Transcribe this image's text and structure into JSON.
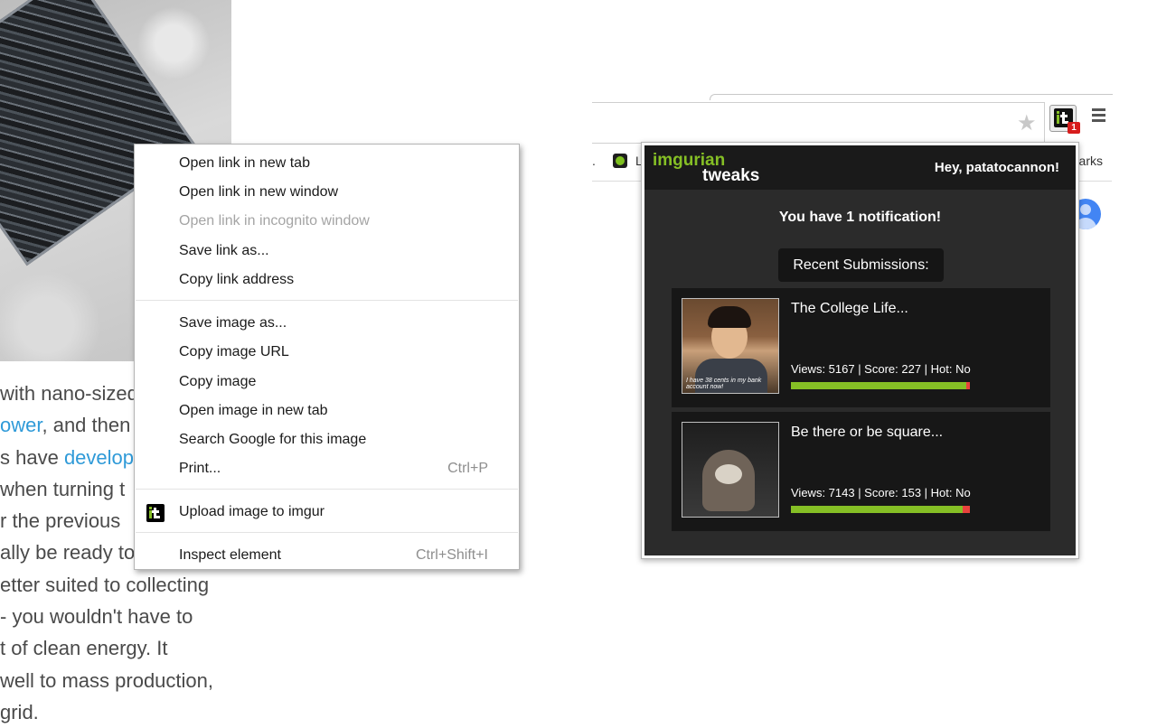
{
  "article": {
    "lines": [
      {
        "text": "with nano-sized",
        "link": ""
      },
      {
        "text": ", and then",
        "link": "ower"
      },
      {
        "text": "s have ",
        "link": "develop"
      },
      {
        "text": " when turning t",
        "link": ""
      },
      {
        "text": "r the previous",
        "link": ""
      },
      {
        "text": "ally be ready to",
        "link": ""
      },
      {
        "text": "etter suited to collecting",
        "link": ""
      },
      {
        "text": "- you wouldn't have to",
        "link": ""
      },
      {
        "text": "t of clean energy. It",
        "link": ""
      },
      {
        "text": "well to mass production,",
        "link": ""
      },
      {
        "text": "grid.",
        "link": ""
      }
    ]
  },
  "context_menu": {
    "group1": [
      "Open link in new tab",
      "Open link in new window",
      "Open link in incognito window",
      "Save link as...",
      "Copy link address"
    ],
    "group2": [
      "Save image as...",
      "Copy image URL",
      "Copy image",
      "Open image in new tab",
      "Search Google for this image",
      "Print..."
    ],
    "print_shortcut": "Ctrl+P",
    "extension_item": "Upload image to imgur",
    "inspect": "Inspect element",
    "inspect_shortcut": "Ctrl+Shift+I"
  },
  "toolbar": {
    "extension_badge": "1",
    "bookmark_fragment": "L",
    "bookmark_dots": ".",
    "bookmarks_fragment": "arks"
  },
  "popup": {
    "logo_top": "imgurian",
    "logo_bottom": "tweaks",
    "greeting": "Hey, patatocannon!",
    "notification": "You have 1 notification!",
    "recent_button": "Recent Submissions:",
    "submissions": [
      {
        "title": "The College Life...",
        "stats": "Views: 5167 | Score: 227 | Hot: No",
        "score_ratio": 0.98,
        "thumb_caption": "I have 38 cents in my bank account now!"
      },
      {
        "title": "Be there or be square...",
        "stats": "Views: 7143 | Score: 153 | Hot: No",
        "score_ratio": 0.96
      }
    ]
  },
  "colors": {
    "accent_green": "#85bf25",
    "bar_red": "#e8423c",
    "popup_bg": "#2b2b2b",
    "link_blue": "#2f9ad8"
  }
}
